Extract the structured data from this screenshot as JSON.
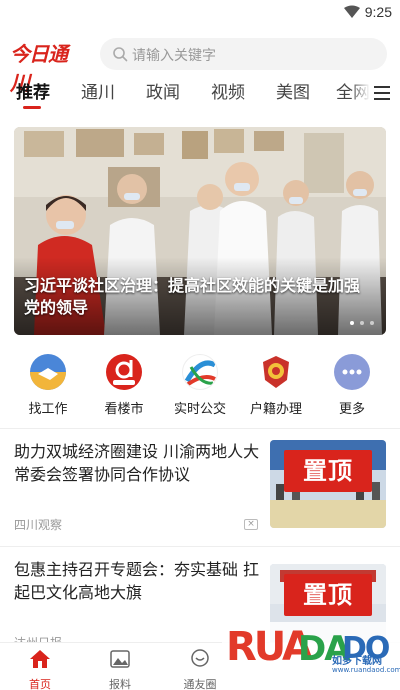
{
  "status_bar": {
    "time": "9:25"
  },
  "header": {
    "logo_text": "今日通川",
    "search_placeholder": "请输入关键字"
  },
  "tabs": [
    {
      "label": "推荐",
      "active": true
    },
    {
      "label": "通川",
      "active": false
    },
    {
      "label": "政闻",
      "active": false
    },
    {
      "label": "视频",
      "active": false
    },
    {
      "label": "美图",
      "active": false
    },
    {
      "label": "全网",
      "active": false
    }
  ],
  "hero": {
    "caption": "习近平谈社区治理：提高社区效能的关键是加强党的领导",
    "dots_total": 3,
    "dots_active": 1
  },
  "services": [
    {
      "label": "找工作",
      "icon": "handshake-icon",
      "color": "#3b7fd6"
    },
    {
      "label": "看楼市",
      "icon": "d-logo-icon",
      "color": "#d9241c"
    },
    {
      "label": "实时公交",
      "icon": "bus-route-icon",
      "color": "#2a8fd6"
    },
    {
      "label": "户籍办理",
      "icon": "police-badge-icon",
      "color": "#c9322a"
    },
    {
      "label": "更多",
      "icon": "more-icon",
      "color": "#7b8fd6"
    }
  ],
  "news": [
    {
      "title": "助力双城经济圈建设 川渝两地人大常委会签署协同合作协议",
      "source": "四川观察",
      "badge": "置顶"
    },
    {
      "title": "包惠主持召开专题会：夯实基础 扛起巴文化高地大旗",
      "source": "达州日报",
      "badge": "置顶"
    }
  ],
  "bottom_nav": [
    {
      "label": "首页",
      "icon": "home-icon",
      "active": true
    },
    {
      "label": "报料",
      "icon": "photo-report-icon",
      "active": false
    },
    {
      "label": "通友圈",
      "icon": "chat-circle-icon",
      "active": false
    }
  ],
  "watermark": {
    "brand": "RUANDADO",
    "cn": "如多下载网",
    "url": "www.ruandaod.com"
  },
  "colors": {
    "accent": "#d9241c"
  }
}
